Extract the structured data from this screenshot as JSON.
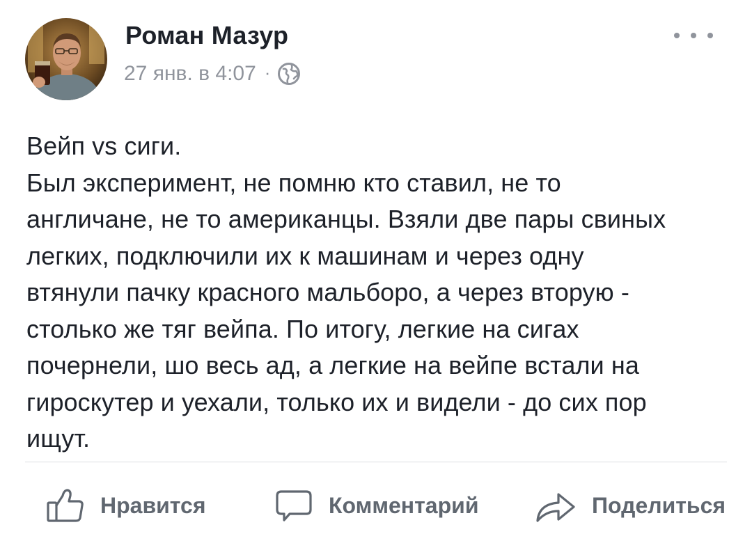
{
  "post": {
    "author": {
      "name": "Роман Мазур"
    },
    "timestamp": "27 янв. в 4:07",
    "separator": "·",
    "privacy_icon": "globe-icon",
    "menu_icon": "more-options-icon",
    "text_lines": [
      "Вейп vs сиги.",
      "Был эксперимент, не помню кто ставил, не то",
      "англичане, не то американцы. Взяли две пары свиных",
      "легких, подключили их к машинам и через одну",
      "втянули пачку красного мальборо, а через вторую -",
      "столько же тяг вейпа. По итогу, легкие на сигах",
      "почернели, шо весь ад, а легкие на вейпе встали на",
      "гироскутер и уехали, только их и видели - до сих пор",
      "ищут."
    ]
  },
  "actions": {
    "like": {
      "label": "Нравится",
      "icon": "thumbs-up-icon"
    },
    "comment": {
      "label": "Комментарий",
      "icon": "comment-bubble-icon"
    },
    "share": {
      "label": "Поделиться",
      "icon": "share-arrow-icon"
    }
  },
  "colors": {
    "text_primary": "#1d2129",
    "text_secondary": "#90949c",
    "action_text": "#606770",
    "divider": "#dadde1",
    "background": "#ffffff"
  }
}
